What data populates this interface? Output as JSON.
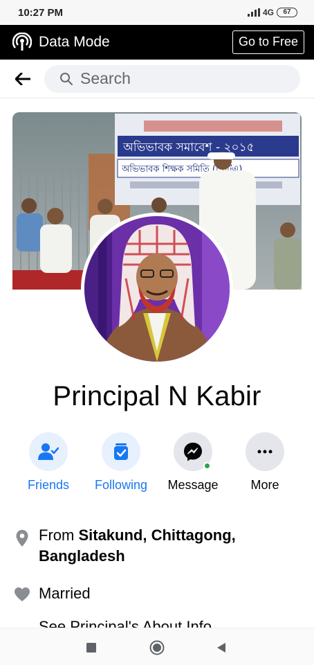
{
  "status_bar": {
    "time": "10:27 PM",
    "network": "4G",
    "battery": "67"
  },
  "data_mode": {
    "title": "Data Mode",
    "go_free_label": "Go to Free"
  },
  "search": {
    "placeholder": "Search"
  },
  "profile": {
    "name": "Principal N Kabir",
    "banner_lines": [
      "অভিভাবক সমাবেশ - ২০১৫",
      "অভিভাবক শিক্ষক সমিতি (পিটিএ)"
    ]
  },
  "actions": [
    {
      "label": "Friends",
      "icon": "friends-icon"
    },
    {
      "label": "Following",
      "icon": "following-icon"
    },
    {
      "label": "Message",
      "icon": "messenger-icon"
    },
    {
      "label": "More",
      "icon": "more-icon"
    }
  ],
  "info": {
    "from_prefix": "From ",
    "from_place_line1": "Sitakund, Chittagong,",
    "from_place_line2": "Bangladesh",
    "relationship": "Married",
    "see_about": "See Principal's About Info"
  },
  "colors": {
    "accent": "#1877f2",
    "online": "#31a24c",
    "data_bar": "#000000"
  }
}
